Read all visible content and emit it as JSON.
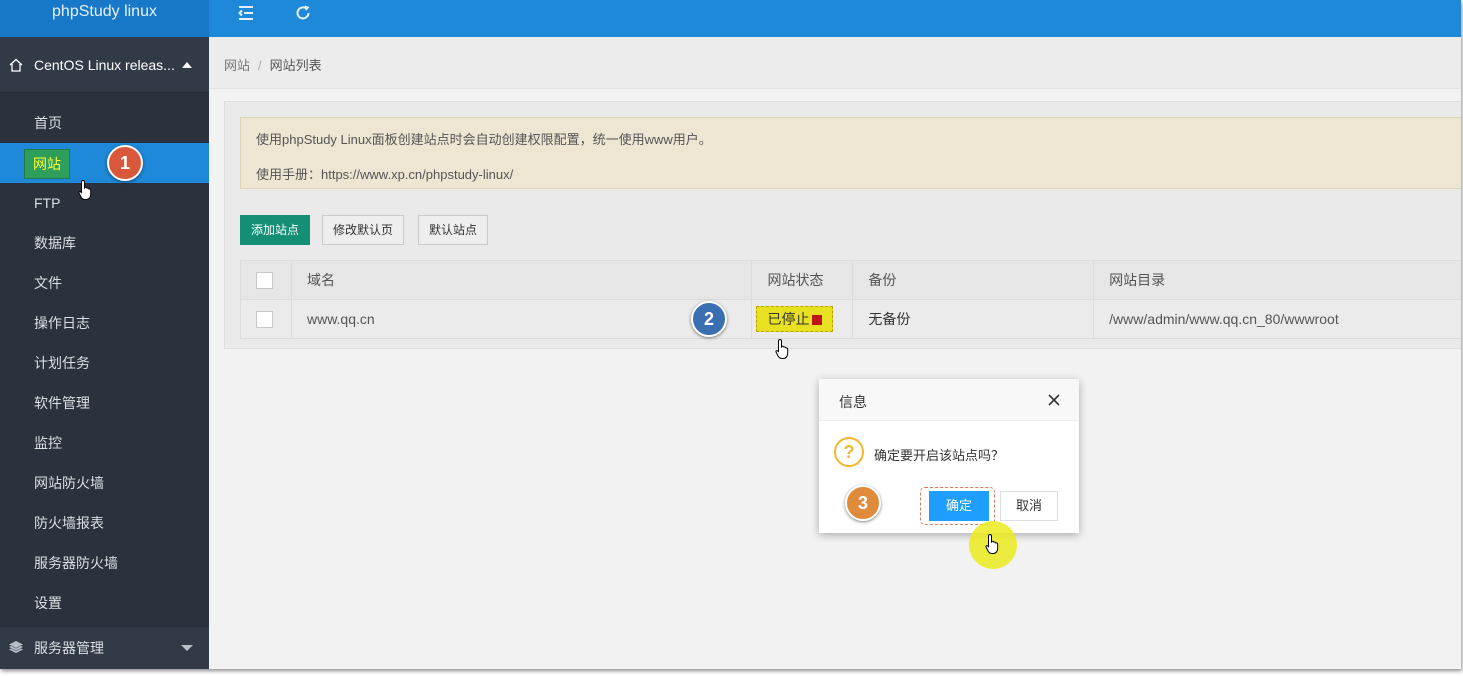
{
  "app": {
    "title": "phpStudy linux"
  },
  "topbar": {
    "icons": [
      "menu-collapse-icon",
      "refresh-icon"
    ]
  },
  "sidebar": {
    "system_label": "CentOS Linux releas...",
    "items": [
      {
        "label": "首页"
      },
      {
        "label": "网站",
        "active": true
      },
      {
        "label": "FTP"
      },
      {
        "label": "数据库"
      },
      {
        "label": "文件"
      },
      {
        "label": "操作日志"
      },
      {
        "label": "计划任务"
      },
      {
        "label": "软件管理"
      },
      {
        "label": "监控"
      },
      {
        "label": "网站防火墙"
      },
      {
        "label": "防火墙报表"
      },
      {
        "label": "服务器防火墙"
      },
      {
        "label": "设置"
      }
    ],
    "group_label": "服务器管理"
  },
  "breadcrumb": {
    "root": "网站",
    "separator": "/",
    "current": "网站列表"
  },
  "notice": {
    "line1": "使用phpStudy Linux面板创建站点时会自动创建权限配置，统一使用www用户。",
    "line2": "使用手册：https://www.xp.cn/phpstudy-linux/"
  },
  "toolbar": {
    "add_site": "添加站点",
    "edit_default_page": "修改默认页",
    "default_site": "默认站点"
  },
  "table": {
    "columns": [
      "域名",
      "网站状态",
      "备份",
      "网站目录"
    ],
    "rows": [
      {
        "domain": "www.qq.cn",
        "status": "已停止",
        "status_color": "#c0141b",
        "backup": "无备份",
        "directory": "/www/admin/www.qq.cn_80/wwwroot"
      }
    ]
  },
  "dialog": {
    "title": "信息",
    "message": "确定要开启该站点吗？",
    "confirm": "确定",
    "cancel": "取消"
  },
  "annotations": {
    "step1": "1",
    "step2": "2",
    "step3": "3"
  },
  "colors": {
    "topbar": "#1e88d9",
    "sidebar": "#2b313d",
    "primary_button": "#148f75",
    "confirm_button": "#1e9fff"
  }
}
